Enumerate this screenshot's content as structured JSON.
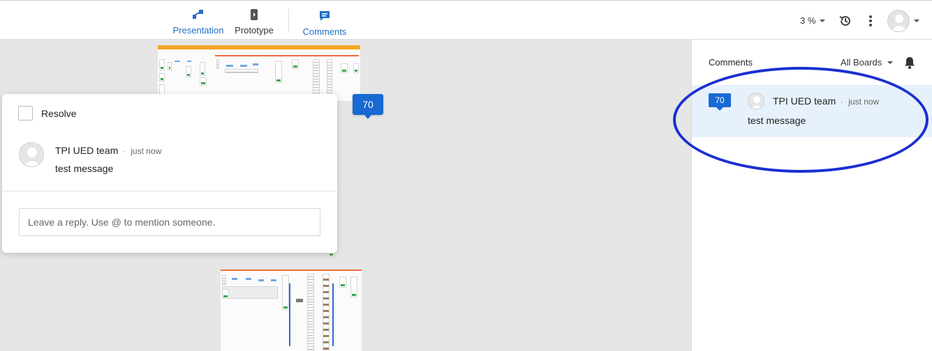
{
  "toolbar": {
    "modes": [
      {
        "label": "Presentation",
        "icon": "presentation-icon"
      },
      {
        "label": "Prototype",
        "icon": "prototype-icon"
      },
      {
        "label": "Comments",
        "icon": "comments-icon",
        "active": true
      }
    ],
    "zoom": "3 %",
    "icons": [
      "history-icon",
      "more-vertical-icon",
      "user-avatar-icon"
    ]
  },
  "canvas": {
    "pin_number": "70"
  },
  "popup": {
    "resolve_label": "Resolve",
    "comment": {
      "author": "TPI UED team",
      "separator": "·",
      "time": "just now",
      "message": "test message"
    },
    "reply_placeholder": "Leave a reply. Use @ to mention someone."
  },
  "panel": {
    "title": "Comments",
    "filter": "All Boards",
    "bell_icon": "bell-icon",
    "items": [
      {
        "pin": "70",
        "author": "TPI UED team",
        "separator": "·",
        "time": "just now",
        "message": "test message"
      }
    ]
  },
  "colors": {
    "accent": "#1869d3",
    "selected_row": "#e6f1fb",
    "annotation_ellipse": "#1a2fd1",
    "canvas_bg": "#e6e6e6"
  }
}
